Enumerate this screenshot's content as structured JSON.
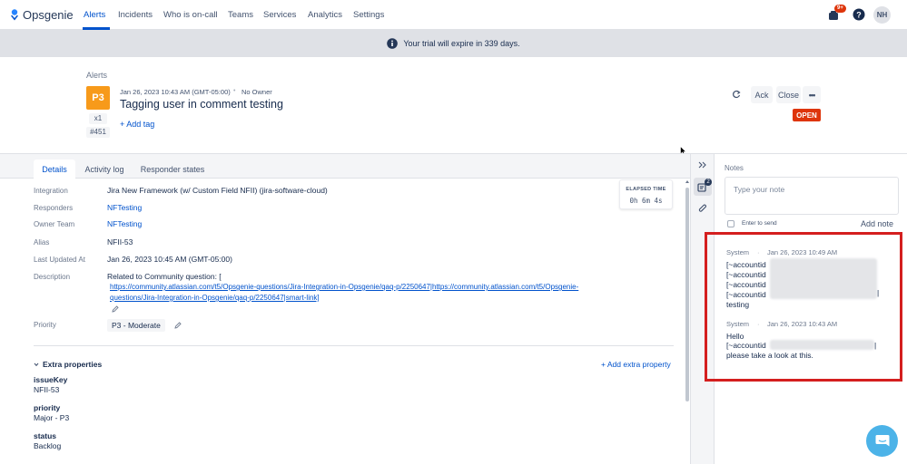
{
  "nav": {
    "brand": "Opsgenie",
    "items": [
      {
        "label": "Alerts"
      },
      {
        "label": "Incidents"
      },
      {
        "label": "Who is on-call"
      },
      {
        "label": "Teams"
      },
      {
        "label": "Services"
      },
      {
        "label": "Analytics"
      },
      {
        "label": "Settings"
      }
    ],
    "notification_badge": "9+",
    "avatar_initials": "NH"
  },
  "banner": {
    "text": "Your trial will expire in 339 days."
  },
  "alert": {
    "breadcrumb": "Alerts",
    "priority": "P3",
    "count": "x1",
    "number": "#451",
    "created": "Jan 26, 2023 10:43 AM (GMT-05:00)",
    "owner": "No Owner",
    "title": "Tagging user in comment testing",
    "add_tag": "+ Add tag",
    "actions": {
      "ack": "Ack",
      "close": "Close",
      "more": "•••"
    },
    "status": "OPEN"
  },
  "tabs": [
    {
      "label": "Details"
    },
    {
      "label": "Activity log"
    },
    {
      "label": "Responder states"
    }
  ],
  "details": {
    "integration_label": "Integration",
    "integration_value": "Jira New Framework (w/ Custom Field NFII) (jira-software-cloud)",
    "responders_label": "Responders",
    "responders_value": "NFTesting",
    "owner_team_label": "Owner Team",
    "owner_team_value": "NFTesting",
    "alias_label": "Alias",
    "alias_value": "NFII-53",
    "last_updated_label": "Last Updated At",
    "last_updated_value": "Jan 26, 2023 10:45 AM (GMT-05:00)",
    "description_label": "Description",
    "description_line1": "Related to Community question: [",
    "description_link1": "https://community.atlassian.com/t5/Opsgenie-questions/Jira-Integration-in-Opsgenie/qaq-p/2250647|https://community.atlassian.com/t5/Opsgenie-",
    "description_link2": "questions/Jira-Integration-in-Opsgenie/qaq-p/2250647|smart-link]",
    "priority_label": "Priority",
    "priority_value": "P3 - Moderate",
    "elapsed_label": "ELAPSED TIME",
    "elapsed_h": "0h",
    "elapsed_m": "6m",
    "elapsed_s": "4s"
  },
  "extra": {
    "title": "Extra properties",
    "add_label": "+ Add extra property",
    "props": [
      {
        "key": "issueKey",
        "value": "NFII-53"
      },
      {
        "key": "priority",
        "value": "Major - P3"
      },
      {
        "key": "status",
        "value": "Backlog"
      }
    ]
  },
  "notes": {
    "title": "Notes",
    "placeholder": "Type your note",
    "enter_to_send": "Enter to send",
    "add_note": "Add note",
    "rail_badge": "2",
    "items": [
      {
        "author": "System",
        "date": "Jan 26, 2023 10:49 AM",
        "lines": [
          "[~accountid",
          "[~accountid",
          "[~accountid",
          "[~accountid",
          "testing"
        ]
      },
      {
        "author": "System",
        "date": "Jan 26, 2023 10:43 AM",
        "lines": [
          "Hello",
          "[~accountid",
          "please take a look at this."
        ]
      }
    ]
  },
  "colors": {
    "accent": "#0052CC",
    "priority": "#F79A1A",
    "open": "#DE350B",
    "highlight": "#D41F1F"
  }
}
